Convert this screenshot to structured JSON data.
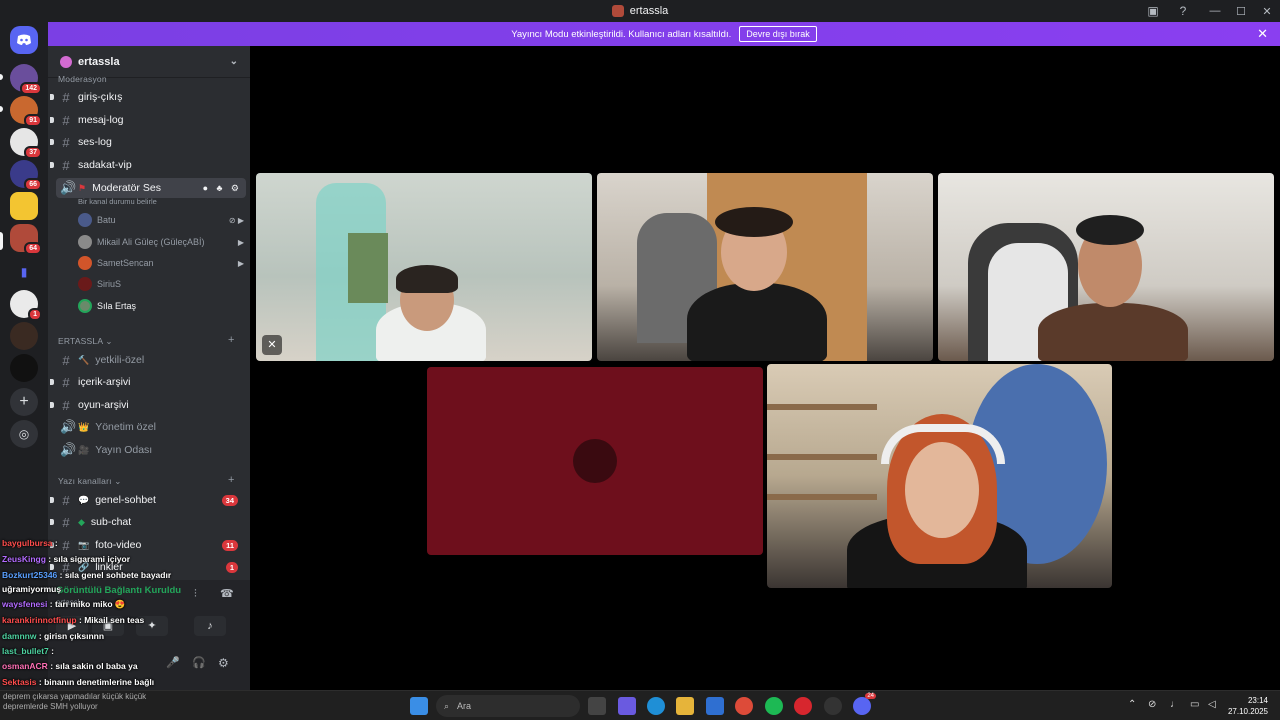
{
  "window": {
    "title": "ertassla",
    "controls": [
      "—",
      "☐",
      "✕"
    ]
  },
  "banner": {
    "text": "Yayıncı Modu etkinleştirildi. Kullanıcı adları kısaltıldı.",
    "button": "Devre dışı bırak"
  },
  "guilds": {
    "badges": [
      "142",
      "91",
      "37",
      "66",
      "64",
      "1"
    ]
  },
  "server": {
    "name": "ertassla"
  },
  "channels": {
    "cat0": "Moderasyon",
    "c1": "giriş-çıkış",
    "c2": "mesaj-log",
    "c3": "ses-log",
    "c4": "sadakat-vip",
    "voice_name": "Moderatör Ses",
    "voice_status": "Bir kanal durumu belirle",
    "members": [
      "Batu",
      "Mikail Ali Güleç (GüleçABİ)",
      "SametSencan",
      "SiriuS",
      "Sıla Ertaş"
    ],
    "cat1": "ERTASSLA",
    "c5": "yetkili-özel",
    "c6": "içerik-arşivi",
    "c7": "oyun-arşivi",
    "c8": "Yönetim özel",
    "c9": "Yayın Odası",
    "cat2": "Yazı kanalları",
    "c10": "genel-sohbet",
    "c10_badge": "34",
    "c11": "sub-chat",
    "c12": "foto-video",
    "c12_badge": "11",
    "c13": "linkler",
    "c13_badge": "1"
  },
  "voice_panel": {
    "status": "Görüntülü Bağlantı Kuruldu",
    "server": "ertassla"
  },
  "chat_overlay": [
    {
      "user": "baygulbursa",
      "msg": ":",
      "color": "#ff4d4d"
    },
    {
      "user": "ZeusKingg",
      "msg": ": sıla sigarami içiyor",
      "color": "#b36bff"
    },
    {
      "user": "Bozkurt25346",
      "msg": ": sıla genel sohbete bayadır",
      "color": "#5aa0ff"
    },
    {
      "user": "",
      "msg": "uğramiyormuş",
      "color": "#ffffff"
    },
    {
      "user": "waysfenesi",
      "msg": ": tarı miko miko 😍",
      "color": "#b36bff"
    },
    {
      "user": "karankirinnotfinup",
      "msg": ": Mikail sen teas",
      "color": "#ff4d4d"
    },
    {
      "user": "damnnw",
      "msg": ": girisn çıksınnn",
      "color": "#4dd2a0"
    },
    {
      "user": "last_bullet7",
      "msg": ":",
      "color": "#4dd2a0"
    },
    {
      "user": "osmanACR",
      "msg": ": sıla sakin ol baba ya",
      "color": "#ff6fb5"
    },
    {
      "user": "Sektasis",
      "msg": ": binanın denetimlerine bağlı",
      "color": "#ff4d4d"
    }
  ],
  "watermark": [
    "deprem çıkarsa yapmadılar küçük küçük",
    "depremlerde SMH yolluyor"
  ],
  "taskbar": {
    "search_placeholder": "Ara",
    "time": "23:14",
    "date": "27.10.2025",
    "notif_badge": "24"
  },
  "colors": {
    "accent": "#5865f2",
    "banner": "#8a3ff0",
    "mention": "#da373c"
  }
}
